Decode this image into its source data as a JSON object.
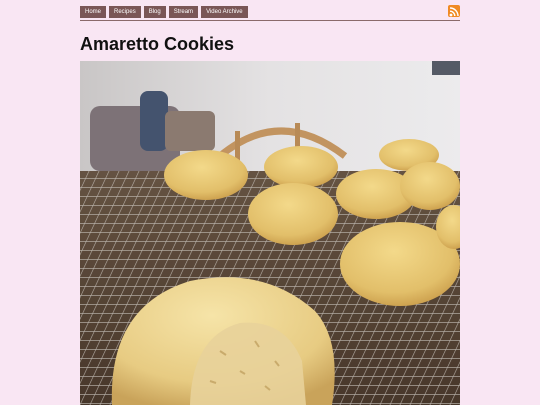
{
  "nav": {
    "items": [
      {
        "label": "Home"
      },
      {
        "label": "Recipes"
      },
      {
        "label": "Blog"
      },
      {
        "label": "Stream"
      },
      {
        "label": "Video Archive"
      }
    ]
  },
  "post": {
    "title": "Amaretto Cookies"
  },
  "colors": {
    "background": "#f9e6f3",
    "nav_button": "#7a5656",
    "rss": "#f08a24"
  },
  "icons": {
    "rss": "rss-feed-icon"
  }
}
